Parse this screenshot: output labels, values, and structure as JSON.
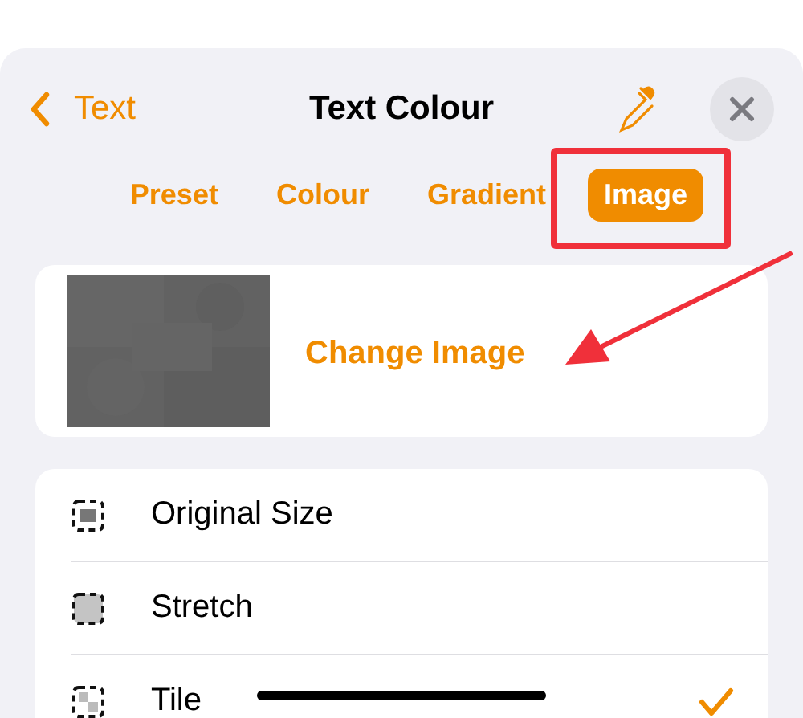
{
  "header": {
    "back_label": "Text",
    "title": "Text Colour"
  },
  "tabs": [
    {
      "label": "Preset",
      "selected": false
    },
    {
      "label": "Colour",
      "selected": false
    },
    {
      "label": "Gradient",
      "selected": false
    },
    {
      "label": "Image",
      "selected": true
    }
  ],
  "image_card": {
    "action": "Change Image"
  },
  "fill_modes": [
    {
      "label": "Original Size",
      "kind": "original",
      "selected": false
    },
    {
      "label": "Stretch",
      "kind": "stretch",
      "selected": false
    },
    {
      "label": "Tile",
      "kind": "tile",
      "selected": true
    }
  ]
}
